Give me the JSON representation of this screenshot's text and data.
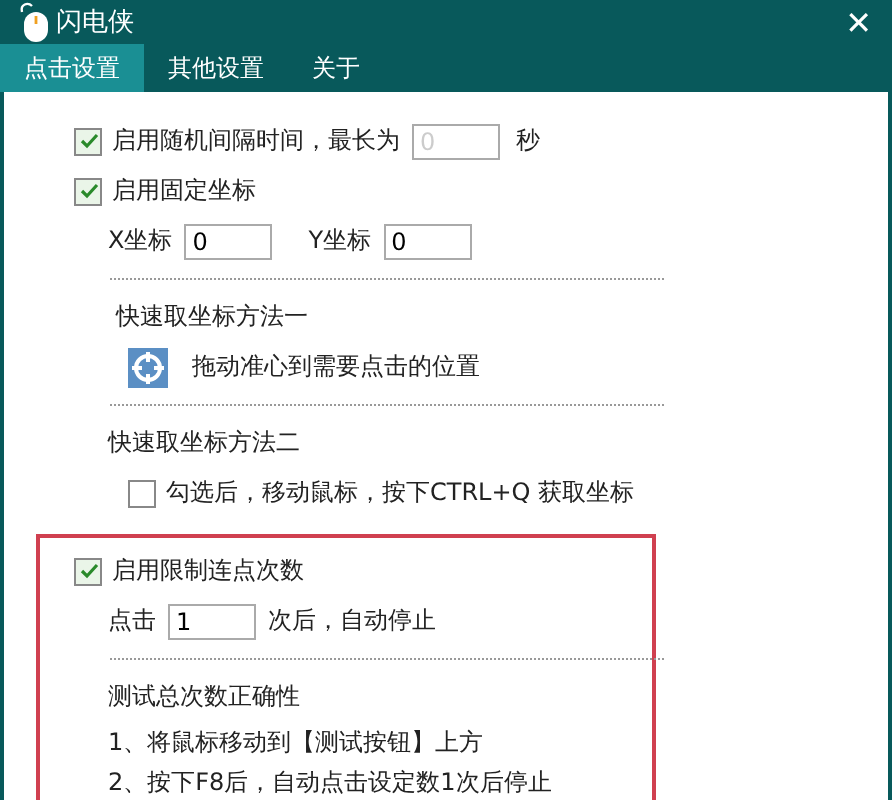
{
  "window": {
    "title": "闪电侠",
    "close": "✕"
  },
  "tabs": [
    {
      "label": "点击设置",
      "selected": true
    },
    {
      "label": "其他设置",
      "selected": false
    },
    {
      "label": "关于",
      "selected": false
    }
  ],
  "random_interval": {
    "label": "启用随机间隔时间，最长为",
    "checked": true,
    "placeholder": "0",
    "unit": "秒"
  },
  "fixed_coords": {
    "label": "启用固定坐标",
    "checked": true,
    "x_label": "X坐标",
    "x_value": "0",
    "y_label": "Y坐标",
    "y_value": "0"
  },
  "method_one": {
    "title": "快速取坐标方法一",
    "hint": "拖动准心到需要点击的位置"
  },
  "method_two": {
    "title": "快速取坐标方法二",
    "label": "勾选后，移动鼠标，按下CTRL+Q 获取坐标",
    "checked": false
  },
  "click_limit": {
    "label": "启用限制连点次数",
    "checked": true,
    "prefix": "点击",
    "value": "1",
    "suffix": "次后，自动停止",
    "test_title": "测试总次数正确性",
    "steps": [
      "1、将鼠标移动到【测试按钮】上方",
      "2、按下F8后，自动点击设定数1次后停止"
    ]
  }
}
